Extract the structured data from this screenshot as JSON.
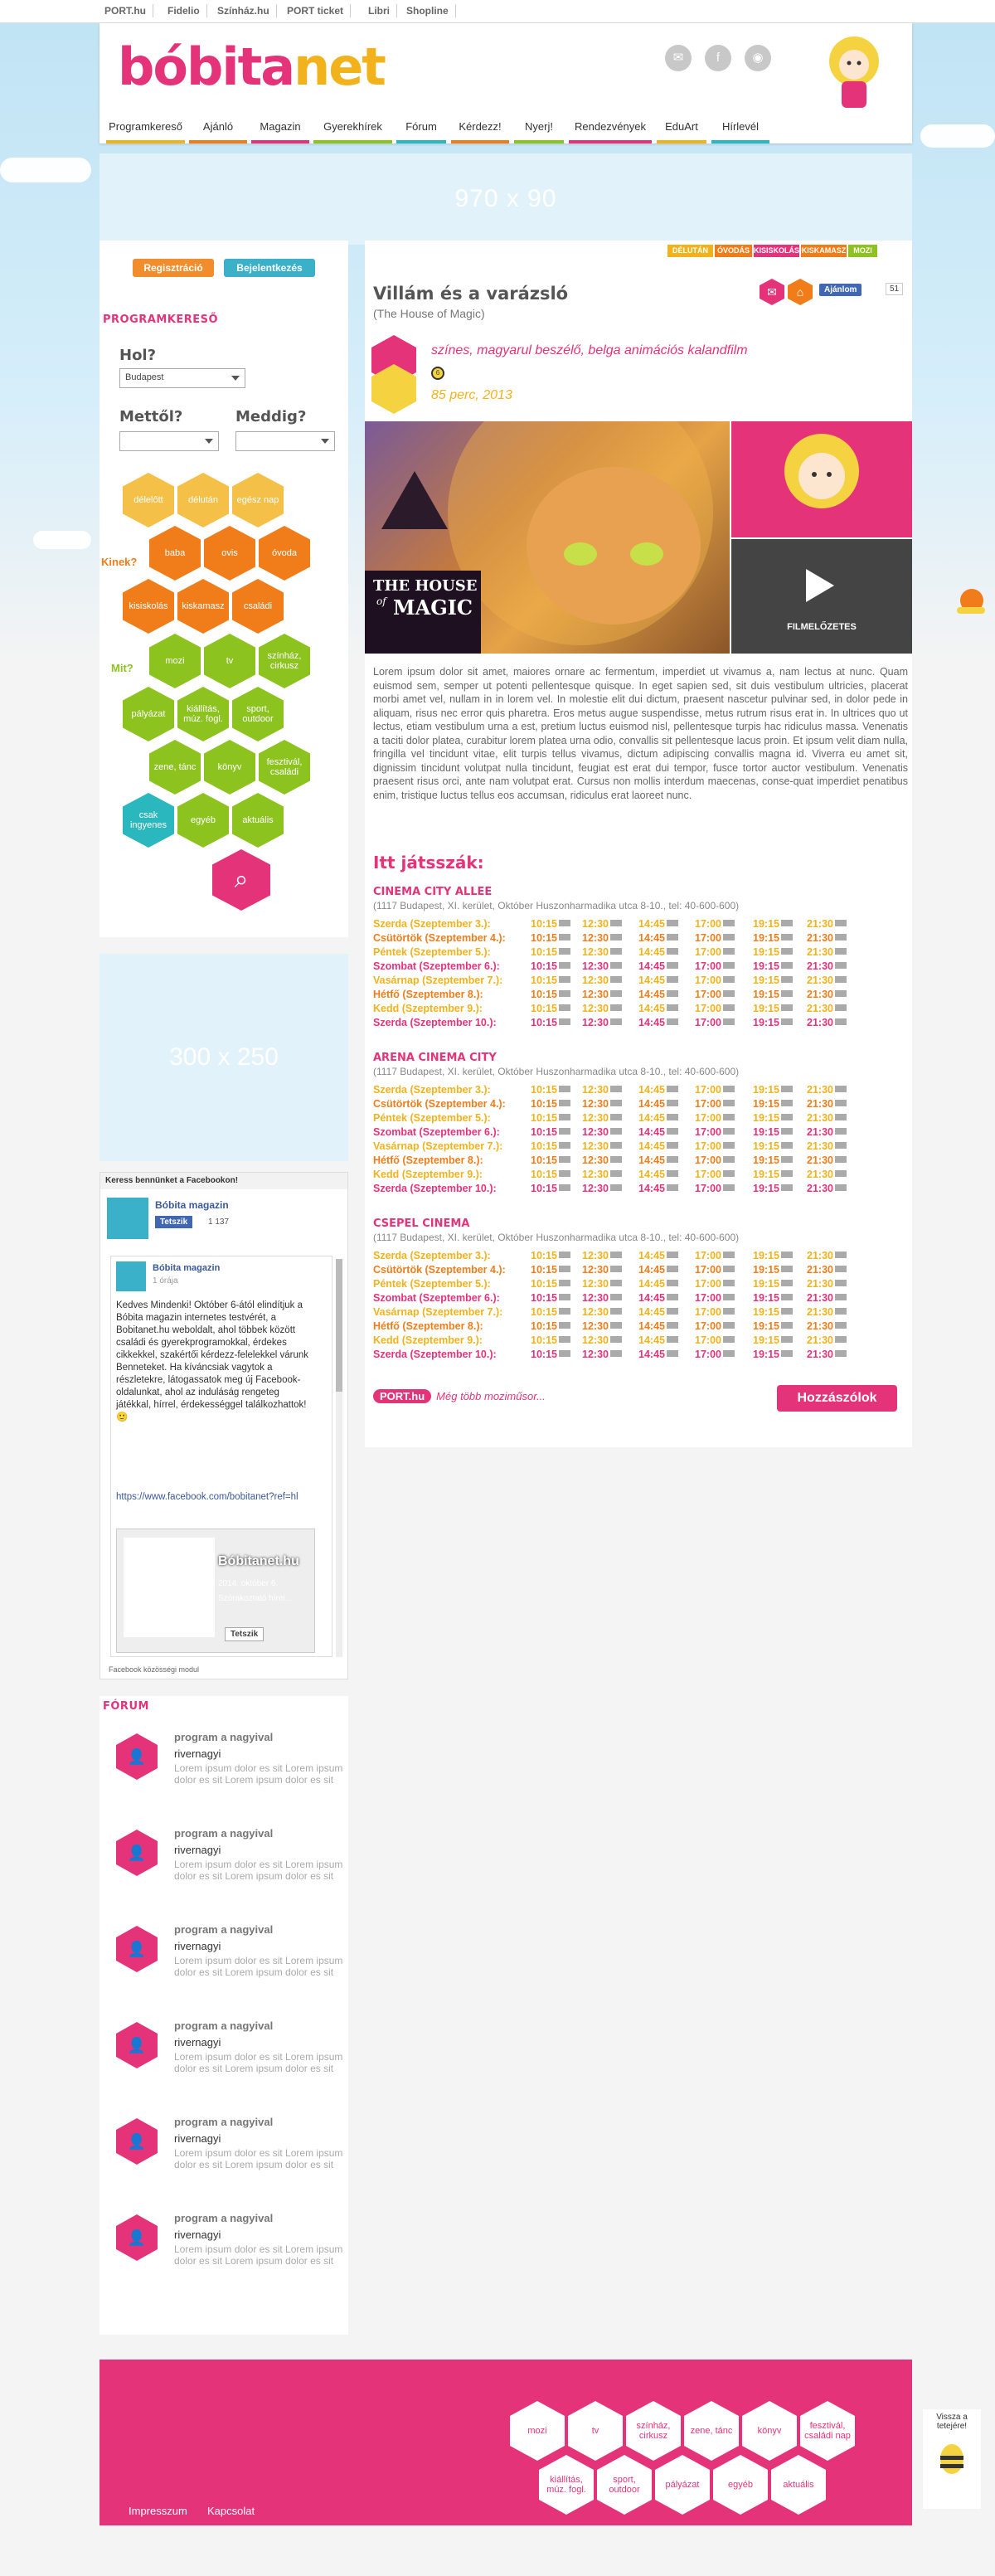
{
  "topbar": {
    "links": [
      "PORT.hu",
      "Fidelio",
      "Színház.hu",
      "PORT ticket",
      "Libri",
      "Shopline"
    ]
  },
  "header": {
    "logo_main": "bóbita",
    "logo_suffix": "net",
    "nav": [
      "Programkereső",
      "Ajánló",
      "Magazin",
      "Gyerekhírek",
      "Fórum",
      "Kérdezz!",
      "Nyerj!",
      "Rendezvények",
      "EduArt",
      "Hírlevél"
    ]
  },
  "ads": {
    "top": "970 x 90",
    "side": "300 x 250"
  },
  "auth": {
    "register": "Regisztráció",
    "login": "Bejelentkezés"
  },
  "search": {
    "title": "PROGRAMKERESŐ",
    "where_label": "Hol?",
    "where_value": "Budapest",
    "from_label": "Mettől?",
    "to_label": "Meddig?",
    "kinek_label": "Kinek?",
    "mit_label": "Mit?",
    "time_hex": [
      "délelőtt",
      "délután",
      "egész nap"
    ],
    "kinek_hex": [
      "baba",
      "ovis",
      "óvoda",
      "kisiskolás",
      "kiskamasz",
      "családi"
    ],
    "mit_hex": [
      "mozi",
      "tv",
      "színház, cirkusz",
      "pályázat",
      "kiállítás, múz. fogl.",
      "sport, outdoor",
      "zene, tánc",
      "könyv",
      "fesztivál, családi",
      "csak ingyenes",
      "egyéb",
      "aktuális"
    ]
  },
  "facebook": {
    "header": "Keress bennünket a Facebookon!",
    "page": "Bóbita magazin",
    "like": "Tetszik",
    "count": "1 137",
    "post_author": "Bóbita magazin",
    "post_time": "1 órája",
    "post_text": "Kedves Mindenki! Október 6-ától elindítjuk a Bóbita magazin internetes testvérét, a Bobitanet.hu weboldalt, ahol többek között családi és gyerekprogramokkal, érdekes cikkekkel, szakértői kérdezz-felelekkel várunk Benneteket. Ha kíváncsiak vagytok a részletekre, látogassatok meg új Facebook-oldalunkat, ahol az induláság rengeteg játékkal, hírrel, érdekességgel találkozhattok! 🙂",
    "post_link": "https://www.facebook.com/bobitanet?ref=hl",
    "card_title": "Bóbitanet.hu",
    "card_date": "2014. október 6.",
    "card_sub": "Szórakoztató hírei...",
    "card_like": "Tetszik",
    "plugin": "Facebook közösségi modul"
  },
  "forum": {
    "title": "FÓRUM",
    "items": [
      {
        "title": "program a nagyival",
        "user": "rivernagyi",
        "text": "Lorem ipsum dolor es sit Lorem ipsum dolor es sit Lorem ipsum dolor es sit"
      },
      {
        "title": "program a nagyival",
        "user": "rivernagyi",
        "text": "Lorem ipsum dolor es sit Lorem ipsum dolor es sit Lorem ipsum dolor es sit"
      },
      {
        "title": "program a nagyival",
        "user": "rivernagyi",
        "text": "Lorem ipsum dolor es sit Lorem ipsum dolor es sit Lorem ipsum dolor es sit"
      },
      {
        "title": "program a nagyival",
        "user": "rivernagyi",
        "text": "Lorem ipsum dolor es sit Lorem ipsum dolor es sit Lorem ipsum dolor es sit"
      },
      {
        "title": "program a nagyival",
        "user": "rivernagyi",
        "text": "Lorem ipsum dolor es sit Lorem ipsum dolor es sit Lorem ipsum dolor es sit"
      },
      {
        "title": "program a nagyival",
        "user": "rivernagyi",
        "text": "Lorem ipsum dolor es sit Lorem ipsum dolor es sit Lorem ipsum dolor es sit"
      }
    ]
  },
  "movie": {
    "tags": [
      "DÉLUTÁN",
      "ÓVODÁS",
      "KISISKOLÁS",
      "KISKAMASZ",
      "MOZI"
    ],
    "title": "Villám és a varázsló",
    "subtitle": "(The House of Magic)",
    "meta1": "színes, magyarul beszélő, belga animációs kalandfilm",
    "meta2": "85 perc, 2013",
    "like": "Ajánlom",
    "like_count": "51",
    "poster_title1": "THE HOUSE",
    "poster_title2": "MAGIC",
    "poster_of": "of",
    "trailer": "FILMELŐZETES",
    "description": "Lorem ipsum dolor sit amet, maiores ornare ac fermentum, imperdiet ut vivamus a, nam lectus at nunc. Quam euismod sem, semper ut potenti pellentesque quisque. In eget sapien sed, sit duis vestibulum ultricies, placerat morbi amet vel, nullam in in lorem vel. In molestie elit dui dictum, praesent nascetur pulvinar sed, in dolor pede in aliquam, risus nec error quis pharetra. Eros metus augue suspendisse, metus rutrum risus erat in. In ultrices quo ut lectus, etiam vestibulum urna a est, pretium luctus euismod nisl, pellentesque turpis hac ridiculus massa. Venenatis a taciti dolor platea, curabitur lorem platea urna odio, convallis sit pellentesque lacus proin. Et ipsum velit diam nulla, fringilla vel tincidunt vitae, elit turpis tellus vivamus, dictum adipiscing convallis magna id. Viverra eu amet sit, dignissim tincidunt volutpat nulla tincidunt, feugiat est erat dui tempor, fusce tortor auctor vestibulum. Venenatis praesent risus orci, ante nam volutpat erat. Cursus non mollis interdum maecenas, conse-quat imperdiet penatibus enim, tristique luctus tellus eos accumsan, ridiculus erat laoreet nunc.",
    "playing_title": "Itt játsszák:",
    "more": "Még több moziműsor...",
    "port_logo": "PORT.hu",
    "comments": "Hozzászólok",
    "times": [
      "10:15",
      "12:30",
      "14:45",
      "17:00",
      "19:15",
      "21:30"
    ],
    "cinemas": [
      {
        "name": "CINEMA CITY ALLEE",
        "addr": "(1117 Budapest, XI. kerület, Október Huszonharmadika utca 8-10., tel: 40-600-600)",
        "days": [
          "Szerda (Szeptember 3.):",
          "Csütörtök (Szeptember 4.):",
          "Péntek (Szeptember 5.):",
          "Szombat (Szeptember 6.):",
          "Vasárnap (Szeptember 7.):",
          "Hétfő (Szeptember 8.):",
          "Kedd (Szeptember 9.):",
          "Szerda (Szeptember 10.):"
        ]
      },
      {
        "name": "ARENA CINEMA CITY",
        "addr": "(1117 Budapest, XI. kerület, Október Huszonharmadika utca 8-10., tel: 40-600-600)",
        "days": [
          "Szerda (Szeptember 3.):",
          "Csütörtök (Szeptember 4.):",
          "Péntek (Szeptember 5.):",
          "Szombat (Szeptember 6.):",
          "Vasárnap (Szeptember 7.):",
          "Hétfő (Szeptember 8.):",
          "Kedd (Szeptember 9.):",
          "Szerda (Szeptember 10.):"
        ]
      },
      {
        "name": "CSEPEL CINEMA",
        "addr": "(1117 Budapest, XI. kerület, Október Huszonharmadika utca 8-10., tel: 40-600-600)",
        "days": [
          "Szerda (Szeptember 3.):",
          "Csütörtök (Szeptember 4.):",
          "Péntek (Szeptember 5.):",
          "Szombat (Szeptember 6.):",
          "Vasárnap (Szeptember 7.):",
          "Hétfő (Szeptember 8.):",
          "Kedd (Szeptember 9.):",
          "Szerda (Szeptember 10.):"
        ]
      }
    ]
  },
  "footer": {
    "links": [
      "Impresszum",
      "Kapcsolat"
    ],
    "hex": [
      "mozi",
      "tv",
      "színház, cirkusz",
      "zene, tánc",
      "könyv",
      "fesztivál, családi nap",
      "kiállítás, múz. fogl.",
      "sport, outdoor",
      "pályázat",
      "egyéb",
      "aktuális"
    ],
    "back_to_top": "Vissza a tetejére!"
  },
  "colors": {
    "pink": "#e5337a",
    "orange": "#f07d1a",
    "yellow": "#f2b21b",
    "green": "#8cc31f",
    "teal": "#2ab7bd"
  }
}
